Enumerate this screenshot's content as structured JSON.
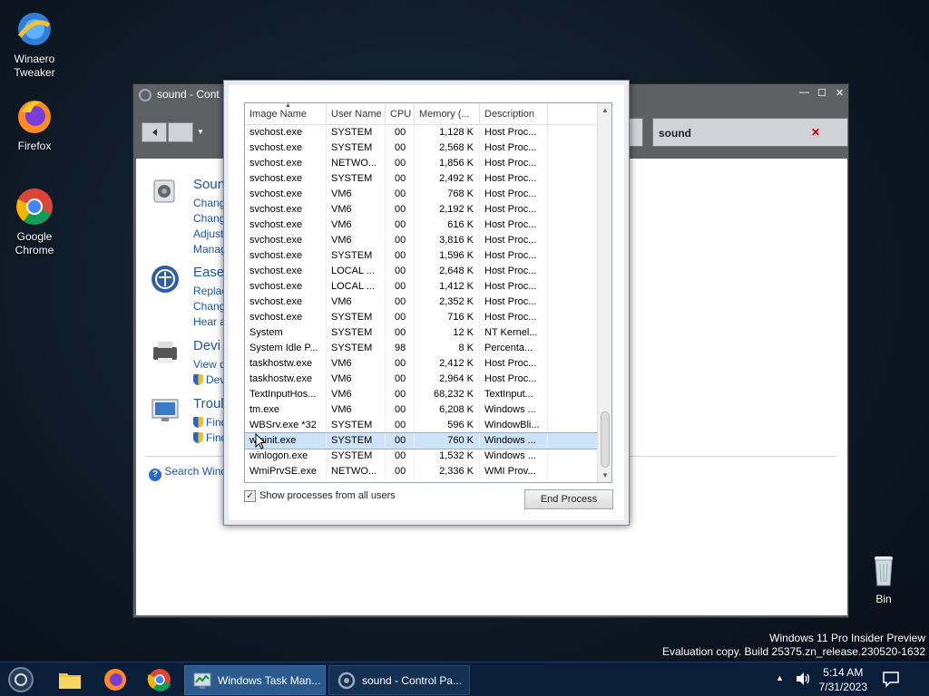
{
  "desktop": {
    "icons": [
      {
        "label": "Winaero\nTweaker"
      },
      {
        "label": "Firefox"
      },
      {
        "label": "Google\nChrome"
      },
      {
        "label": "Bin"
      }
    ],
    "watermark_line1": "Windows 11 Pro Insider Preview",
    "watermark_line2": "Evaluation copy. Build 25375.zn_release.230520-1632"
  },
  "control_panel": {
    "title": "sound - Cont",
    "search_value": "sound",
    "categories": [
      {
        "title": "Soun",
        "links": [
          "Chang",
          "Chang",
          "Adjust",
          "Manag"
        ]
      },
      {
        "title": "Ease",
        "links": [
          "Replac",
          "Chang",
          "Hear a"
        ]
      },
      {
        "title": "Devi",
        "links": [
          "View d",
          "Dev"
        ]
      },
      {
        "title": "Troul",
        "links": [
          "Find",
          "Find"
        ]
      }
    ],
    "search_windows": "Search Wind"
  },
  "task_manager": {
    "columns": [
      "Image Name",
      "User Name",
      "CPU",
      "Memory (...",
      "Description"
    ],
    "rows": [
      [
        "svchost.exe",
        "SYSTEM",
        "00",
        "1,128 K",
        "Host Proc..."
      ],
      [
        "svchost.exe",
        "SYSTEM",
        "00",
        "2,568 K",
        "Host Proc..."
      ],
      [
        "svchost.exe",
        "NETWO...",
        "00",
        "1,856 K",
        "Host Proc..."
      ],
      [
        "svchost.exe",
        "SYSTEM",
        "00",
        "2,492 K",
        "Host Proc..."
      ],
      [
        "svchost.exe",
        "VM6",
        "00",
        "768 K",
        "Host Proc..."
      ],
      [
        "svchost.exe",
        "VM6",
        "00",
        "2,192 K",
        "Host Proc..."
      ],
      [
        "svchost.exe",
        "VM6",
        "00",
        "616 K",
        "Host Proc..."
      ],
      [
        "svchost.exe",
        "VM6",
        "00",
        "3,816 K",
        "Host Proc..."
      ],
      [
        "svchost.exe",
        "SYSTEM",
        "00",
        "1,596 K",
        "Host Proc..."
      ],
      [
        "svchost.exe",
        "LOCAL ...",
        "00",
        "2,648 K",
        "Host Proc..."
      ],
      [
        "svchost.exe",
        "LOCAL ...",
        "00",
        "1,412 K",
        "Host Proc..."
      ],
      [
        "svchost.exe",
        "VM6",
        "00",
        "2,352 K",
        "Host Proc..."
      ],
      [
        "svchost.exe",
        "SYSTEM",
        "00",
        "716 K",
        "Host Proc..."
      ],
      [
        "System",
        "SYSTEM",
        "00",
        "12 K",
        "NT Kernel..."
      ],
      [
        "System Idle P...",
        "SYSTEM",
        "98",
        "8 K",
        "Percenta..."
      ],
      [
        "taskhostw.exe",
        "VM6",
        "00",
        "2,412 K",
        "Host Proc..."
      ],
      [
        "taskhostw.exe",
        "VM6",
        "00",
        "2,964 K",
        "Host Proc..."
      ],
      [
        "TextInputHos...",
        "VM6",
        "00",
        "68,232 K",
        "TextInput..."
      ],
      [
        "tm.exe",
        "VM6",
        "00",
        "6,208 K",
        "Windows ..."
      ],
      [
        "WBSrv.exe *32",
        "SYSTEM",
        "00",
        "596 K",
        "WindowBli..."
      ],
      [
        "wininit.exe",
        "SYSTEM",
        "00",
        "760 K",
        "Windows ..."
      ],
      [
        "winlogon.exe",
        "SYSTEM",
        "00",
        "1,532 K",
        "Windows ..."
      ],
      [
        "WmiPrvSE.exe",
        "NETWO...",
        "00",
        "2,336 K",
        "WMI Prov..."
      ]
    ],
    "selected_row": 20,
    "show_all_label": "Show processes from all users",
    "show_all_checked": "✓",
    "end_process_label": "End Process"
  },
  "taskbar": {
    "task_manager_label": "Windows Task Man...",
    "control_panel_label": "sound - Control Pa...",
    "time": "5:14 AM",
    "date": "7/31/2023"
  }
}
